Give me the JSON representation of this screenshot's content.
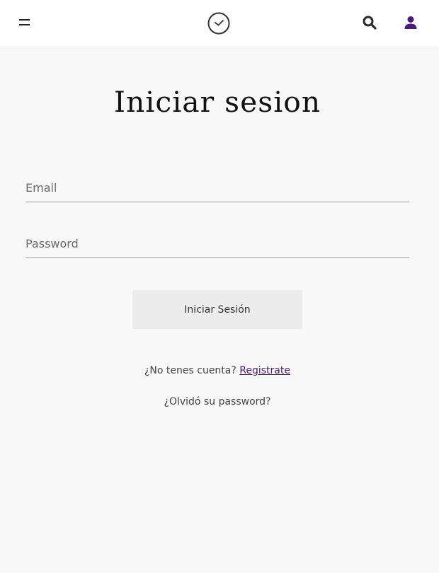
{
  "header": {
    "menu_icon": "hamburger-menu-icon",
    "logo_icon": "clock-logo-icon",
    "search_icon": "search-icon",
    "user_icon": "user-icon",
    "user_icon_color": "#4b1a7a"
  },
  "login": {
    "title": "Iniciar sesion",
    "email_placeholder": "Email",
    "password_placeholder": "Password",
    "submit_label": "Iniciar Sesión",
    "no_account_text": "¿No tenes cuenta? ",
    "register_link": "Registrate",
    "forgot_password": "¿Olvidó su password?"
  }
}
